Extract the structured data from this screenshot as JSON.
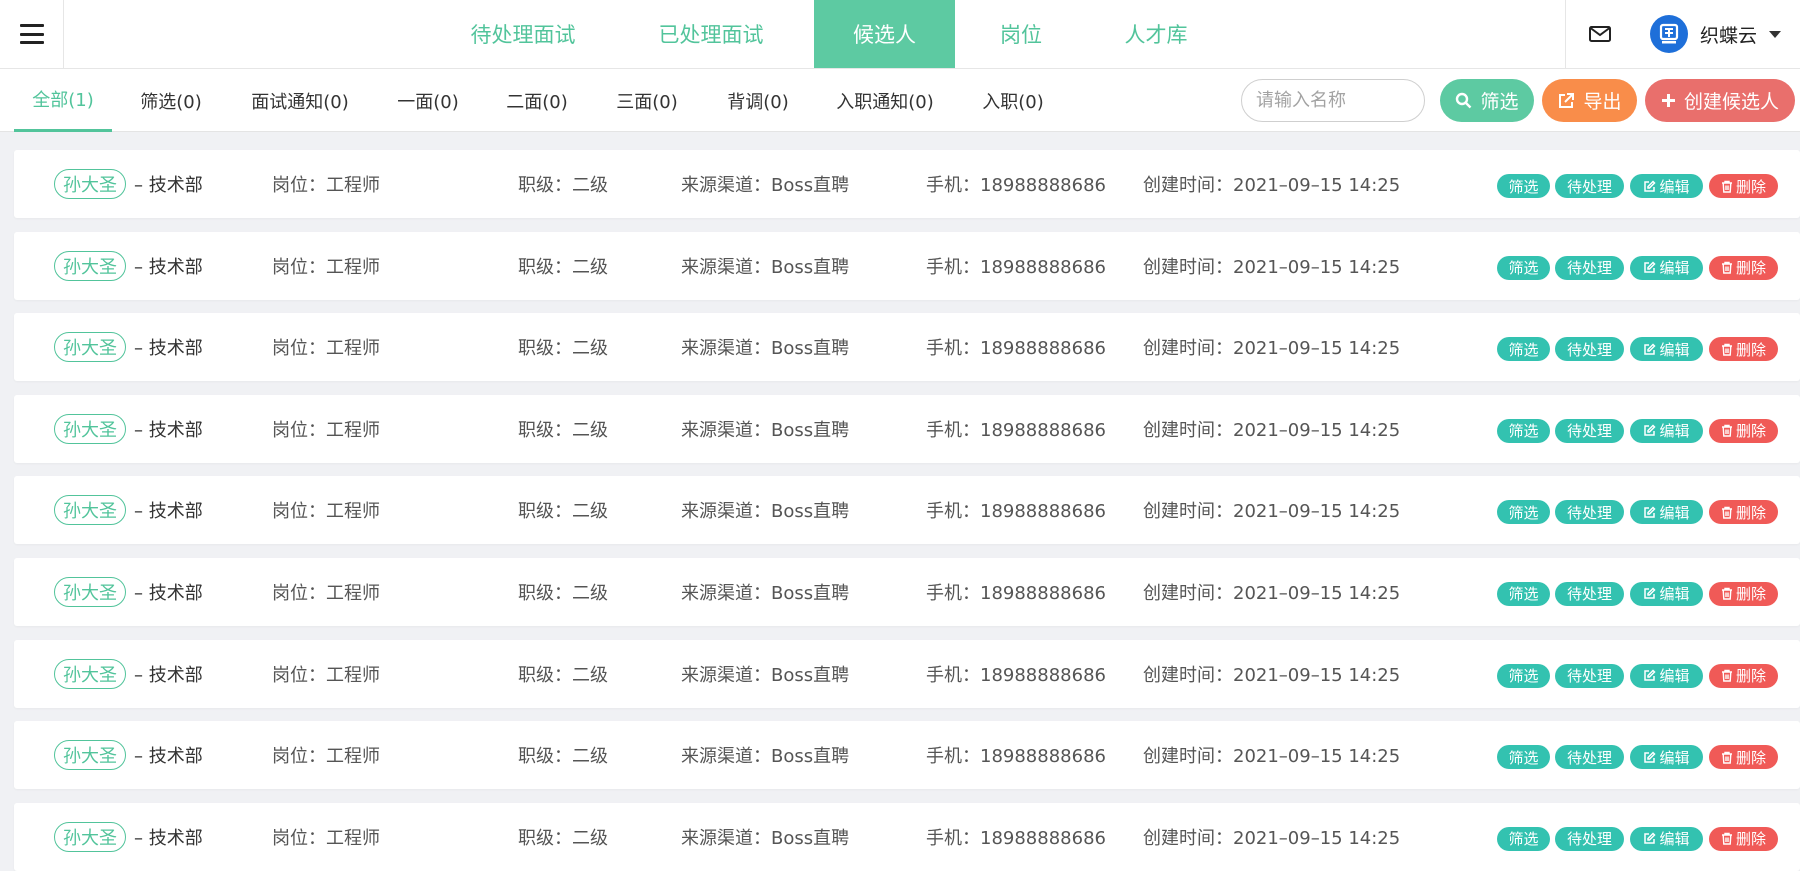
{
  "topnav": {
    "items": [
      {
        "label": "待处理面试",
        "active": false
      },
      {
        "label": "已处理面试",
        "active": false
      },
      {
        "label": "候选人",
        "active": true
      },
      {
        "label": "岗位",
        "active": false
      },
      {
        "label": "人才库",
        "active": false
      }
    ]
  },
  "org": {
    "name": "织蝶云"
  },
  "status_tabs": [
    {
      "label": "全部(1)",
      "active": true
    },
    {
      "label": "筛选(0)",
      "active": false
    },
    {
      "label": "面试通知(0)",
      "active": false
    },
    {
      "label": "一面(0)",
      "active": false
    },
    {
      "label": "二面(0)",
      "active": false
    },
    {
      "label": "三面(0)",
      "active": false
    },
    {
      "label": "背调(0)",
      "active": false
    },
    {
      "label": "入职通知(0)",
      "active": false
    },
    {
      "label": "入职(0)",
      "active": false
    }
  ],
  "toolbar": {
    "search_placeholder": "请输入名称",
    "search_value": "",
    "filter_label": "筛选",
    "export_label": "导出",
    "create_label": "创建候选人"
  },
  "colors": {
    "brand_green": "#52c49b",
    "active_nav_bg": "#5dcaa2",
    "tag_teal": "#33c2b0",
    "delete_red": "#f05a57",
    "export_orange": "#f98d4a",
    "create_red": "#e96f6c"
  },
  "row_actions": {
    "filter": "筛选",
    "pending": "待处理",
    "edit": "编辑",
    "delete": "删除"
  },
  "candidates": [
    {
      "name": "孙大圣",
      "dept": "– 技术部",
      "position": "岗位：工程师",
      "level": "职级：二级",
      "source": "来源渠道：Boss直聘",
      "phone": "手机：18988888686",
      "created": "创建时间：2021–09–15 14:25"
    },
    {
      "name": "孙大圣",
      "dept": "– 技术部",
      "position": "岗位：工程师",
      "level": "职级：二级",
      "source": "来源渠道：Boss直聘",
      "phone": "手机：18988888686",
      "created": "创建时间：2021–09–15 14:25"
    },
    {
      "name": "孙大圣",
      "dept": "– 技术部",
      "position": "岗位：工程师",
      "level": "职级：二级",
      "source": "来源渠道：Boss直聘",
      "phone": "手机：18988888686",
      "created": "创建时间：2021–09–15 14:25"
    },
    {
      "name": "孙大圣",
      "dept": "– 技术部",
      "position": "岗位：工程师",
      "level": "职级：二级",
      "source": "来源渠道：Boss直聘",
      "phone": "手机：18988888686",
      "created": "创建时间：2021–09–15 14:25"
    },
    {
      "name": "孙大圣",
      "dept": "– 技术部",
      "position": "岗位：工程师",
      "level": "职级：二级",
      "source": "来源渠道：Boss直聘",
      "phone": "手机：18988888686",
      "created": "创建时间：2021–09–15 14:25"
    },
    {
      "name": "孙大圣",
      "dept": "– 技术部",
      "position": "岗位：工程师",
      "level": "职级：二级",
      "source": "来源渠道：Boss直聘",
      "phone": "手机：18988888686",
      "created": "创建时间：2021–09–15 14:25"
    },
    {
      "name": "孙大圣",
      "dept": "– 技术部",
      "position": "岗位：工程师",
      "level": "职级：二级",
      "source": "来源渠道：Boss直聘",
      "phone": "手机：18988888686",
      "created": "创建时间：2021–09–15 14:25"
    },
    {
      "name": "孙大圣",
      "dept": "– 技术部",
      "position": "岗位：工程师",
      "level": "职级：二级",
      "source": "来源渠道：Boss直聘",
      "phone": "手机：18988888686",
      "created": "创建时间：2021–09–15 14:25"
    },
    {
      "name": "孙大圣",
      "dept": "– 技术部",
      "position": "岗位：工程师",
      "level": "职级：二级",
      "source": "来源渠道：Boss直聘",
      "phone": "手机：18988888686",
      "created": "创建时间：2021–09–15 14:25"
    }
  ]
}
